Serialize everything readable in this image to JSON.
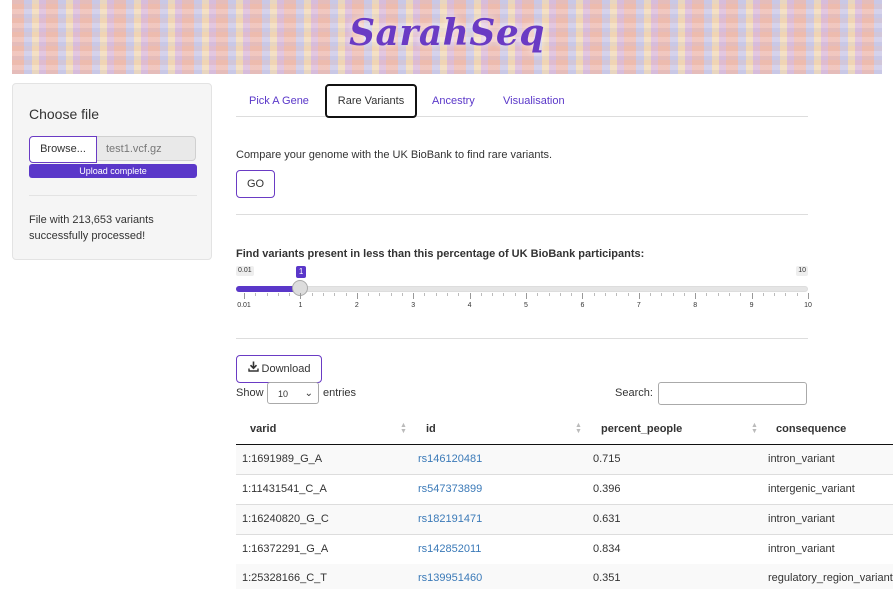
{
  "app": {
    "title": "SarahSeq"
  },
  "colors": {
    "accent": "#5a37c9",
    "link": "#3b7ab8"
  },
  "sidebar": {
    "choose_label": "Choose file",
    "browse_label": "Browse...",
    "file_name": "test1.vcf.gz",
    "upload_status": "Upload complete",
    "upload_progress": 1.0,
    "processed_line1": "File with 213,653 variants",
    "processed_line2": "successfully processed!"
  },
  "tabs": [
    {
      "label": "Pick A Gene",
      "active": false
    },
    {
      "label": "Rare Variants",
      "active": true
    },
    {
      "label": "Ancestry",
      "active": false
    },
    {
      "label": "Visualisation",
      "active": false
    }
  ],
  "rare": {
    "intro": "Compare your genome with the UK BioBank to find rare variants.",
    "go_label": "GO",
    "slider_label": "Find variants present in less than this percentage of UK BioBank participants:",
    "slider_min_label": "0.01",
    "slider_max_label": "10",
    "slider_value_label": "1",
    "slider_min": 0.01,
    "slider_max": 10,
    "slider_value": 1,
    "tick_labels": [
      "0.01",
      "1",
      "2",
      "3",
      "4",
      "5",
      "6",
      "7",
      "8",
      "9",
      "10"
    ]
  },
  "table_controls": {
    "download_label": "Download",
    "download_icon": "download-icon",
    "show_label": "Show",
    "entries_value": "10",
    "entries_label": "entries",
    "search_label": "Search:",
    "search_value": ""
  },
  "table": {
    "columns": [
      "varid",
      "id",
      "percent_people",
      "consequence"
    ],
    "rows": [
      [
        "1:1691989_G_A",
        "rs146120481",
        "0.715",
        "intron_variant"
      ],
      [
        "1:11431541_C_A",
        "rs547373899",
        "0.396",
        "intergenic_variant"
      ],
      [
        "1:16240820_G_C",
        "rs182191471",
        "0.631",
        "intron_variant"
      ],
      [
        "1:16372291_G_A",
        "rs142852011",
        "0.834",
        "intron_variant"
      ],
      [
        "1:25328166_C_T",
        "rs139951460",
        "0.351",
        "regulatory_region_variant"
      ]
    ]
  }
}
